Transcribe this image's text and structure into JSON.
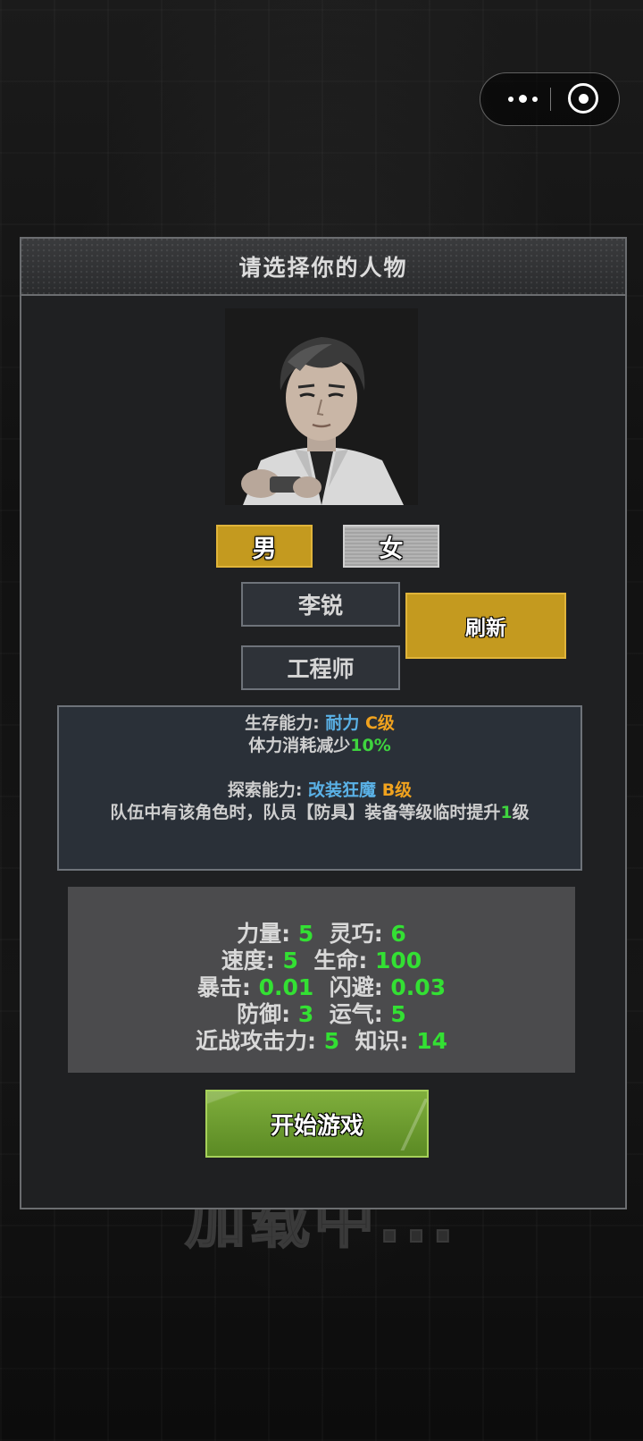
{
  "capsule": {
    "more_icon": "more-dots-icon",
    "close_icon": "target-circle-icon"
  },
  "background": {
    "loading_text": "加载中..."
  },
  "dialog": {
    "title": "请选择你的人物",
    "gender": {
      "male": "男",
      "female": "女",
      "selected": "男"
    },
    "name": "李锐",
    "job": "工程师",
    "refresh_label": "刷新",
    "abilities": {
      "survival_prefix": "生存能力: ",
      "survival_name": "耐力",
      "survival_grade": "C级",
      "survival_desc_text": "体力消耗减少",
      "survival_desc_value": "10%",
      "explore_prefix": "探索能力: ",
      "explore_name": "改装狂魔",
      "explore_grade": "B级",
      "explore_desc_text": "队伍中有该角色时，队员【防具】装备等级临时提升",
      "explore_desc_value": "1",
      "explore_desc_suffix": "级"
    },
    "stats": {
      "strength_label": "力量: ",
      "strength": "5",
      "agility_label": "灵巧: ",
      "agility": "6",
      "speed_label": "速度: ",
      "speed": "5",
      "hp_label": "生命: ",
      "hp": "100",
      "crit_label": "暴击: ",
      "crit": "0.01",
      "dodge_label": "闪避: ",
      "dodge": "0.03",
      "defense_label": "防御: ",
      "defense": "3",
      "luck_label": "运气: ",
      "luck": "5",
      "melee_label": "近战攻击力: ",
      "melee": "5",
      "knowledge_label": "知识: ",
      "knowledge": "14"
    },
    "start_label": "开始游戏"
  },
  "colors": {
    "gold": "#c49a1f",
    "highlight_blue": "#5ab1e6",
    "highlight_orange": "#f0a21e",
    "value_green": "#33e033",
    "start_green": "#6b9c2f"
  }
}
